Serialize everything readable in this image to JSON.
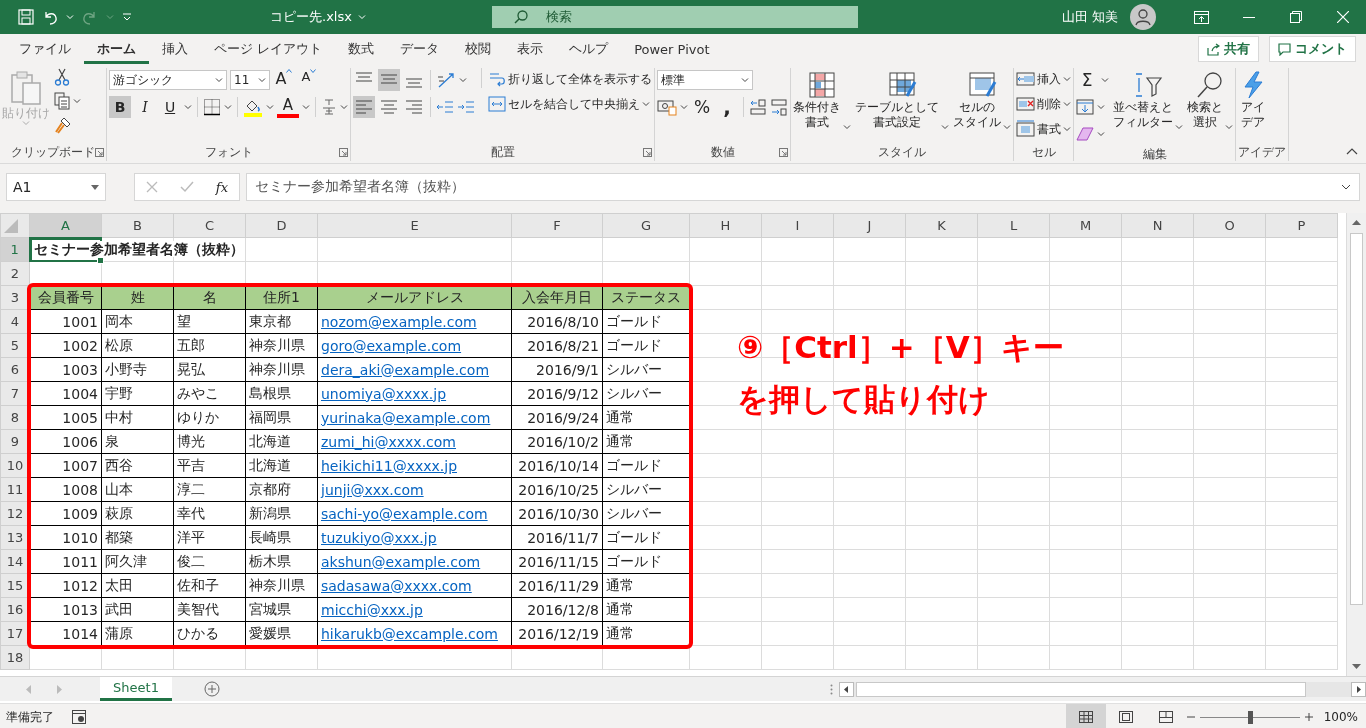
{
  "title_bar": {
    "file_name": "コピー先.xlsx",
    "search_placeholder": "検索",
    "user_name": "山田 知美"
  },
  "menu_tabs": [
    {
      "label": "ファイル",
      "selected": false
    },
    {
      "label": "ホーム",
      "selected": true
    },
    {
      "label": "挿入",
      "selected": false
    },
    {
      "label": "ページ レイアウト",
      "selected": false
    },
    {
      "label": "数式",
      "selected": false
    },
    {
      "label": "データ",
      "selected": false
    },
    {
      "label": "校閲",
      "selected": false
    },
    {
      "label": "表示",
      "selected": false
    },
    {
      "label": "ヘルプ",
      "selected": false
    },
    {
      "label": "Power Pivot",
      "selected": false
    }
  ],
  "share_button": {
    "label": "共有"
  },
  "comment_button": {
    "label": "コメント"
  },
  "ribbon": [
    {
      "kind": "clipboard",
      "label": "クリップボード",
      "paste_label": "貼り付け",
      "paste_disabled": true
    },
    {
      "kind": "font",
      "label": "フォント",
      "font_name": "游ゴシック",
      "font_size": "11",
      "grow_label": "A",
      "shrink_label": "A",
      "font_color_label": "A",
      "styles": [
        {
          "label": "B",
          "selected": true
        },
        {
          "label": "I",
          "selected": false
        },
        {
          "label": "U",
          "selected": false
        }
      ]
    },
    {
      "kind": "alignment",
      "label": "配置",
      "vertical": [
        {
          "selected": false
        },
        {
          "selected": true
        },
        {
          "selected": false
        }
      ],
      "horizontal": [
        {
          "selected": true
        },
        {
          "selected": false
        },
        {
          "selected": false
        }
      ],
      "wrap_label": "折り返して全体を表示する",
      "merge_label": "セルを結合して中央揃え"
    },
    {
      "kind": "number",
      "label": "数値",
      "format": "標準",
      "percent_label": "%",
      "comma_label": ","
    },
    {
      "kind": "styles",
      "label": "スタイル",
      "buttons": [
        [
          "条件付き",
          "書式"
        ],
        [
          "テーブルとして",
          "書式設定"
        ],
        [
          "セルの",
          "スタイル"
        ]
      ]
    },
    {
      "kind": "cells",
      "label": "セル",
      "buttons": [
        "挿入",
        "削除",
        "書式"
      ]
    },
    {
      "kind": "editing",
      "label": "編集",
      "autosum_label": "Σ",
      "buttons": [
        [
          "並べ替えと",
          "フィルター"
        ],
        [
          "検索と",
          "選択"
        ]
      ]
    },
    {
      "kind": "ideas",
      "label": "アイデア",
      "buttons": [
        [
          "アイ",
          "デア"
        ]
      ]
    }
  ],
  "formula_bar": {
    "name_box": "A1",
    "function_label": "fx",
    "formula": "セミナー参加希望者名簿（抜粋）"
  },
  "sheet": {
    "columns": [
      {
        "label": "A",
        "selected": true
      },
      {
        "label": "B",
        "selected": false
      },
      {
        "label": "C",
        "selected": false
      },
      {
        "label": "D",
        "selected": false
      },
      {
        "label": "E",
        "selected": false
      },
      {
        "label": "F",
        "selected": false
      },
      {
        "label": "G",
        "selected": false
      },
      {
        "label": "H",
        "selected": false
      },
      {
        "label": "I",
        "selected": false
      },
      {
        "label": "J",
        "selected": false
      },
      {
        "label": "K",
        "selected": false
      },
      {
        "label": "L",
        "selected": false
      },
      {
        "label": "M",
        "selected": false
      },
      {
        "label": "N",
        "selected": false
      },
      {
        "label": "O",
        "selected": false
      },
      {
        "label": "P",
        "selected": false
      }
    ],
    "rows": [
      {
        "number": "1",
        "selected": true,
        "kind": "title",
        "cells": [
          "セミナー参加希望者名簿（抜粋）"
        ]
      },
      {
        "number": "2",
        "selected": false,
        "kind": "blank"
      },
      {
        "number": "3",
        "selected": false,
        "kind": "header",
        "cells": [
          "会員番号",
          "姓",
          "名",
          "住所1",
          "メールアドレス",
          "入会年月日",
          "ステータス"
        ]
      },
      {
        "number": "4",
        "selected": false,
        "kind": "data",
        "cells": [
          "1001",
          "岡本",
          "望",
          "東京都",
          "nozom@example.com",
          "2016/8/10",
          "ゴールド"
        ]
      },
      {
        "number": "5",
        "selected": false,
        "kind": "data",
        "cells": [
          "1002",
          "松原",
          "五郎",
          "神奈川県",
          "goro@example.com",
          "2016/8/21",
          "ゴールド"
        ]
      },
      {
        "number": "6",
        "selected": false,
        "kind": "data",
        "cells": [
          "1003",
          "小野寺",
          "晃弘",
          "神奈川県",
          "dera_aki@example.com",
          "2016/9/1",
          "シルバー"
        ]
      },
      {
        "number": "7",
        "selected": false,
        "kind": "data",
        "cells": [
          "1004",
          "宇野",
          "みやこ",
          "島根県",
          "unomiya@xxxx.jp",
          "2016/9/12",
          "シルバー"
        ]
      },
      {
        "number": "8",
        "selected": false,
        "kind": "data",
        "cells": [
          "1005",
          "中村",
          "ゆりか",
          "福岡県",
          "yurinaka@example.com",
          "2016/9/24",
          "通常"
        ]
      },
      {
        "number": "9",
        "selected": false,
        "kind": "data",
        "cells": [
          "1006",
          "泉",
          "博光",
          "北海道",
          "zumi_hi@xxxx.com",
          "2016/10/2",
          "通常"
        ]
      },
      {
        "number": "10",
        "selected": false,
        "kind": "data",
        "cells": [
          "1007",
          "西谷",
          "平吉",
          "北海道",
          "heikichi11@xxxx.jp",
          "2016/10/14",
          "ゴールド"
        ]
      },
      {
        "number": "11",
        "selected": false,
        "kind": "data",
        "cells": [
          "1008",
          "山本",
          "淳二",
          "京都府",
          "junji@xxx.com",
          "2016/10/25",
          "シルバー"
        ]
      },
      {
        "number": "12",
        "selected": false,
        "kind": "data",
        "cells": [
          "1009",
          "萩原",
          "幸代",
          "新潟県",
          "sachi-yo@example.com",
          "2016/10/30",
          "シルバー"
        ]
      },
      {
        "number": "13",
        "selected": false,
        "kind": "data",
        "cells": [
          "1010",
          "都築",
          "洋平",
          "長崎県",
          "tuzukiyo@xxx.jp",
          "2016/11/7",
          "ゴールド"
        ]
      },
      {
        "number": "14",
        "selected": false,
        "kind": "data",
        "cells": [
          "1011",
          "阿久津",
          "俊二",
          "栃木県",
          "akshun@example.com",
          "2016/11/15",
          "ゴールド"
        ]
      },
      {
        "number": "15",
        "selected": false,
        "kind": "data",
        "cells": [
          "1012",
          "太田",
          "佐和子",
          "神奈川県",
          "sadasawa@xxxx.com",
          "2016/11/29",
          "通常"
        ]
      },
      {
        "number": "16",
        "selected": false,
        "kind": "data",
        "cells": [
          "1013",
          "武田",
          "美智代",
          "宮城県",
          "micchi@xxx.jp",
          "2016/12/8",
          "通常"
        ]
      },
      {
        "number": "17",
        "selected": false,
        "kind": "data",
        "cells": [
          "1014",
          "蒲原",
          "ひかる",
          "愛媛県",
          "hikarukb@excample.com",
          "2016/12/19",
          "通常"
        ]
      },
      {
        "number": "18",
        "selected": false,
        "kind": "blank"
      }
    ],
    "callout": {
      "lines": [
        "⑨［Ctrl］+［V］キー",
        "を押して貼り付け"
      ]
    }
  },
  "sheet_tabs": [
    {
      "label": "Sheet1",
      "selected": true
    }
  ],
  "status_bar": {
    "status": "準備完了",
    "views": [
      {
        "selected": true
      },
      {
        "selected": false
      },
      {
        "selected": false
      }
    ],
    "zoom": {
      "level": 0.5
    },
    "zoom_label": "100%"
  }
}
